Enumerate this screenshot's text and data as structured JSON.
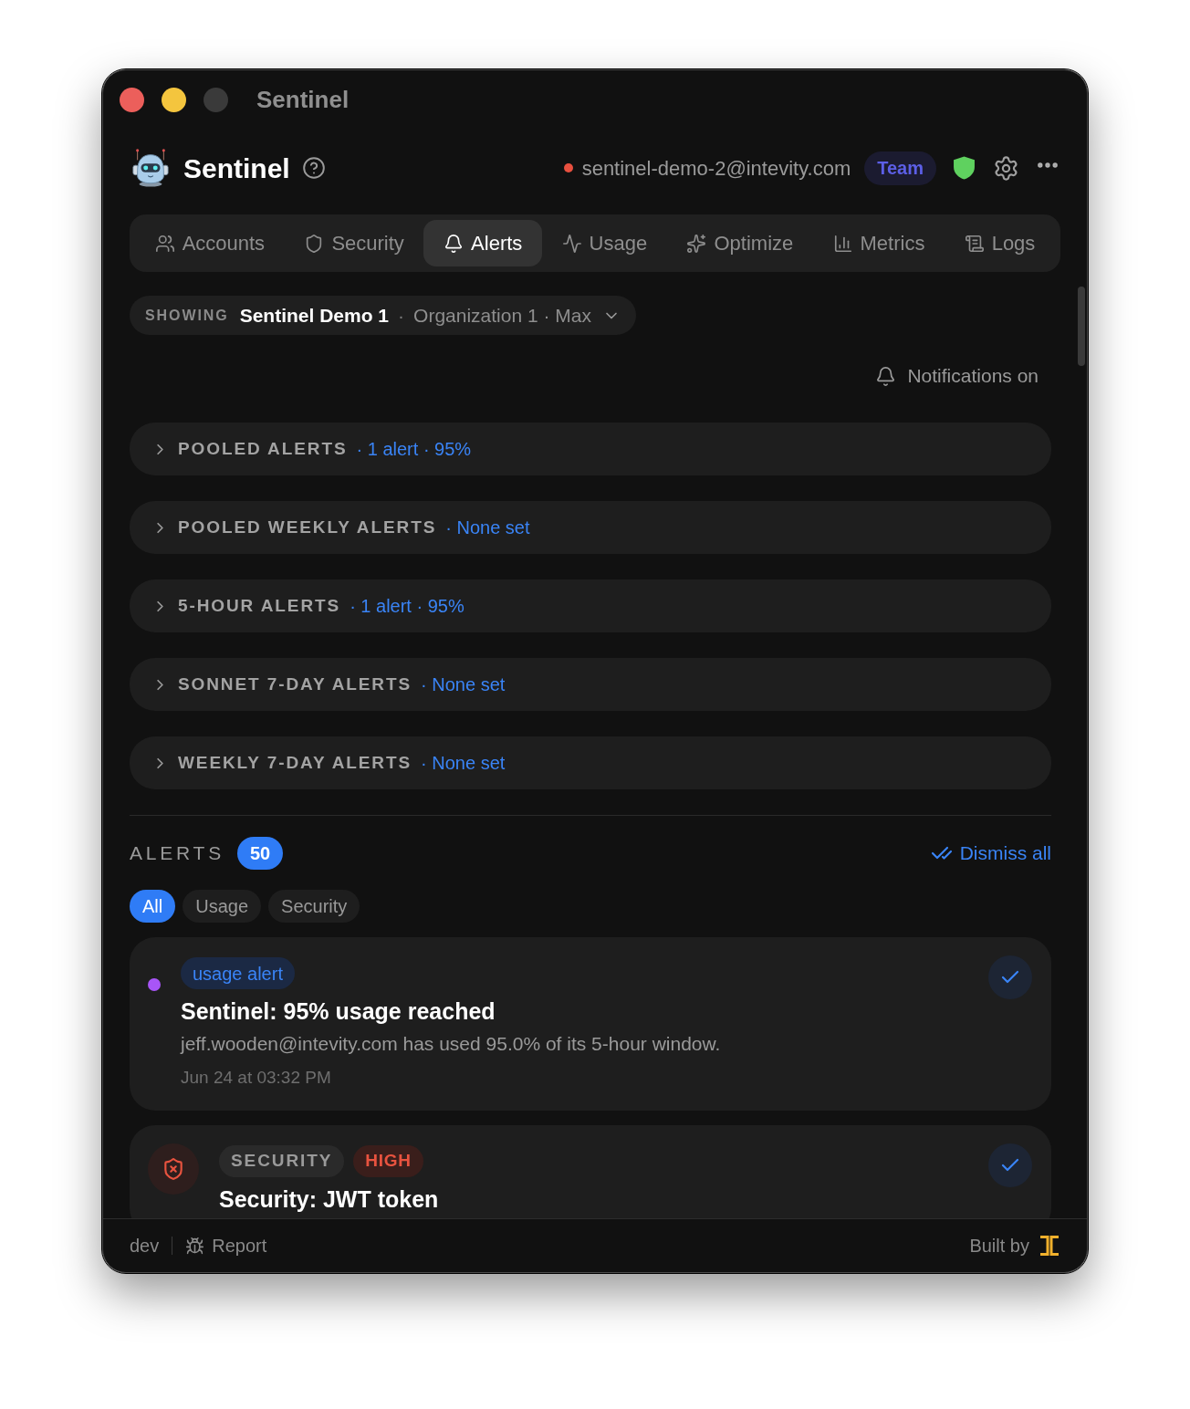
{
  "window": {
    "title": "Sentinel"
  },
  "header": {
    "app_name": "Sentinel",
    "account_email": "sentinel-demo-2@intevity.com",
    "plan": "Team"
  },
  "tabs": [
    {
      "label": "Accounts",
      "selected": false
    },
    {
      "label": "Security",
      "selected": false
    },
    {
      "label": "Alerts",
      "selected": true
    },
    {
      "label": "Usage",
      "selected": false
    },
    {
      "label": "Optimize",
      "selected": false
    },
    {
      "label": "Metrics",
      "selected": false
    },
    {
      "label": "Logs",
      "selected": false
    }
  ],
  "scope": {
    "label": "SHOWING",
    "account": "Sentinel Demo 1",
    "separator": "·",
    "detail": "Organization 1 · Max"
  },
  "notifications": {
    "label": "Notifications on",
    "on": true
  },
  "alert_groups": [
    {
      "title": "POOLED ALERTS",
      "summary": "· 1 alert · 95%",
      "expanded": false
    },
    {
      "title": "POOLED WEEKLY ALERTS",
      "summary": "· None set",
      "expanded": false
    },
    {
      "title": "5-HOUR ALERTS",
      "summary": "· 1 alert · 95%",
      "expanded": false
    },
    {
      "title": "SONNET 7-DAY ALERTS",
      "summary": "· None set",
      "expanded": false
    },
    {
      "title": "WEEKLY 7-DAY ALERTS",
      "summary": "· None set",
      "expanded": false
    }
  ],
  "alerts": {
    "title": "ALERTS",
    "count": "50",
    "dismiss_all": "Dismiss all",
    "filters": [
      {
        "label": "All",
        "selected": true
      },
      {
        "label": "Usage",
        "selected": false
      },
      {
        "label": "Security",
        "selected": false
      }
    ],
    "items": [
      {
        "kind": "usage",
        "tags": [
          {
            "kind": "usage",
            "label": "usage alert"
          }
        ],
        "title": "Sentinel: 95% usage reached",
        "description": "jeff.wooden@intevity.com has used 95.0% of its 5-hour window.",
        "time": "Jun 24 at 03:32 PM"
      },
      {
        "kind": "security",
        "tags": [
          {
            "kind": "category",
            "label": "SECURITY"
          },
          {
            "kind": "severity_high",
            "label": "HIGH"
          }
        ],
        "title": "Security: JWT token"
      }
    ]
  },
  "footer": {
    "environment": "dev",
    "report": "Report",
    "built_by": "Built by"
  }
}
